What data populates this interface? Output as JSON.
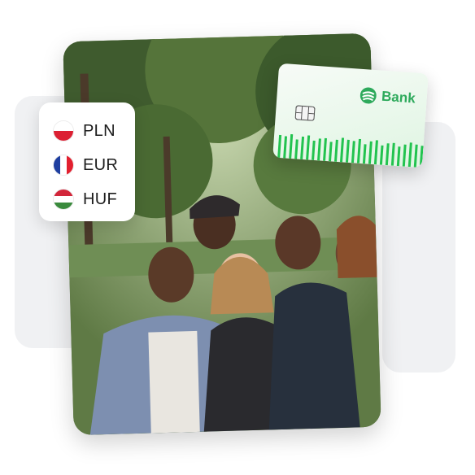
{
  "currencies": [
    {
      "code": "PLN",
      "flag": "poland-flag-icon"
    },
    {
      "code": "EUR",
      "flag": "france-flag-icon"
    },
    {
      "code": "HUF",
      "flag": "hungary-flag-icon"
    }
  ],
  "bank_card": {
    "brand": "Bank",
    "logo": "bank-logo-icon",
    "chip": "card-chip-icon"
  },
  "photo": {
    "subject": "group-of-friends-photo"
  },
  "colors": {
    "brand_green": "#2eaa5c",
    "stripe_green": "#22c34f",
    "card_tint": "#dff5e2"
  }
}
